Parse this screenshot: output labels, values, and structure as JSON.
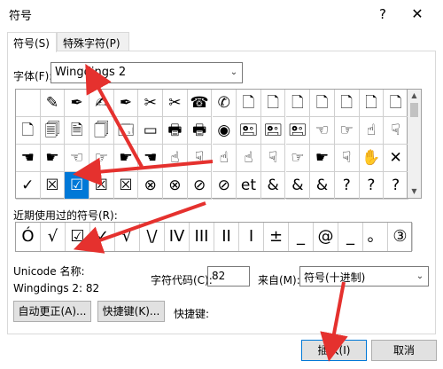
{
  "window": {
    "title": "符号",
    "help": "?",
    "close": "✕"
  },
  "tabs": [
    {
      "label": "符号(S)"
    },
    {
      "label": "特殊字符(P)"
    }
  ],
  "font": {
    "label": "字体(F):",
    "value": "Wingdings 2",
    "arrow": "⌄"
  },
  "grid": {
    "rows": [
      [
        "",
        "✎",
        "✒",
        "✍",
        "✒",
        "✂",
        "✂",
        "☎",
        "✆",
        "🗋",
        "🗋",
        "🗋",
        "🗋",
        "🗋",
        "🗋",
        "🗋"
      ],
      [
        "🗋",
        "🗐",
        "🗎",
        "🗍",
        "🗔",
        "▭",
        "🖶",
        "🖶",
        "◉",
        "🖭",
        "🖭",
        "🖭",
        "☜",
        "☞",
        "☝",
        "☟"
      ],
      [
        "☚",
        "☛",
        "☜",
        "☞",
        "☛",
        "☚",
        "☝",
        "☟",
        "☝",
        "☝",
        "☟",
        "☞",
        "☛",
        "☟",
        "✋",
        "✕"
      ],
      [
        "✓",
        "☒",
        "☑",
        "☒",
        "☒",
        "⊗",
        "⊗",
        "⊘",
        "⊘",
        "et",
        "&",
        "&",
        "&",
        "?",
        "?",
        "?"
      ]
    ],
    "selected": {
      "row": 3,
      "col": 2
    }
  },
  "recent": {
    "label": "近期使用过的符号(R):",
    "items": [
      "Ó",
      "√",
      "☑",
      "✓",
      "√",
      "\\/",
      "IV",
      "III",
      "II",
      "I",
      "±",
      "_",
      "@",
      "_",
      "。",
      "③"
    ]
  },
  "unicode": {
    "label": "Unicode 名称:",
    "description": "Wingdings 2: 82"
  },
  "code": {
    "label": "字符代码(C):",
    "value": "82"
  },
  "from": {
    "label": "来自(M):",
    "value": "符号(十进制)",
    "arrow": "⌄"
  },
  "buttons": {
    "autocorrect": "自动更正(A)...",
    "shortcut_key": "快捷键(K)...",
    "shortcut_label": "快捷键:",
    "insert": "插入(I)",
    "cancel": "取消"
  },
  "scrollbar": {
    "up": "▲",
    "down": "▼"
  },
  "colors": {
    "selection": "#0078d7",
    "annotation_arrow": "#e5312e"
  }
}
